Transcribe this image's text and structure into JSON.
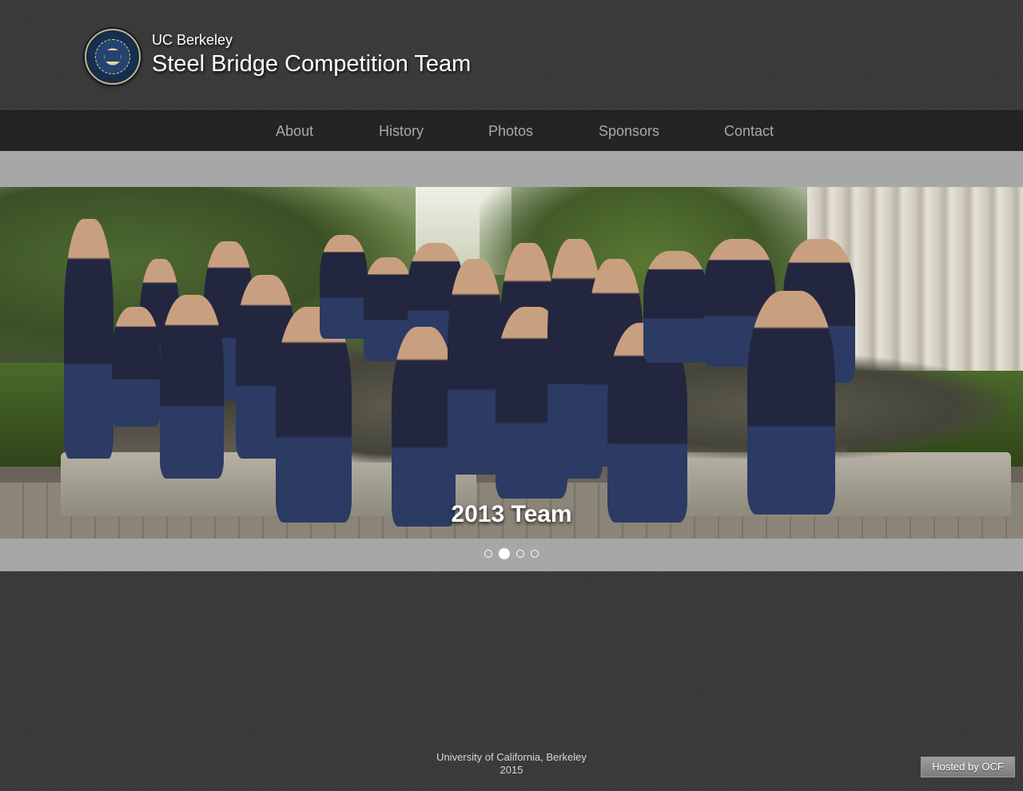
{
  "header": {
    "subtitle": "UC Berkeley",
    "title": "Steel Bridge Competition Team",
    "logo_icon": "uc-seal-icon"
  },
  "nav": {
    "items": [
      {
        "label": "About"
      },
      {
        "label": "History"
      },
      {
        "label": "Photos"
      },
      {
        "label": "Sponsors"
      },
      {
        "label": "Contact"
      }
    ]
  },
  "slider": {
    "caption": "2013 Team",
    "slide_count": 4,
    "active_slide": 2
  },
  "footer": {
    "line1": "University of California, Berkeley",
    "line2": "2015"
  },
  "badge": {
    "label": "Hosted by OCF"
  },
  "colors": {
    "background": "#3a3a3a",
    "nav_bg": "#242424",
    "nav_text": "#a9a9a9",
    "slider_band": "#a7a7a7"
  }
}
